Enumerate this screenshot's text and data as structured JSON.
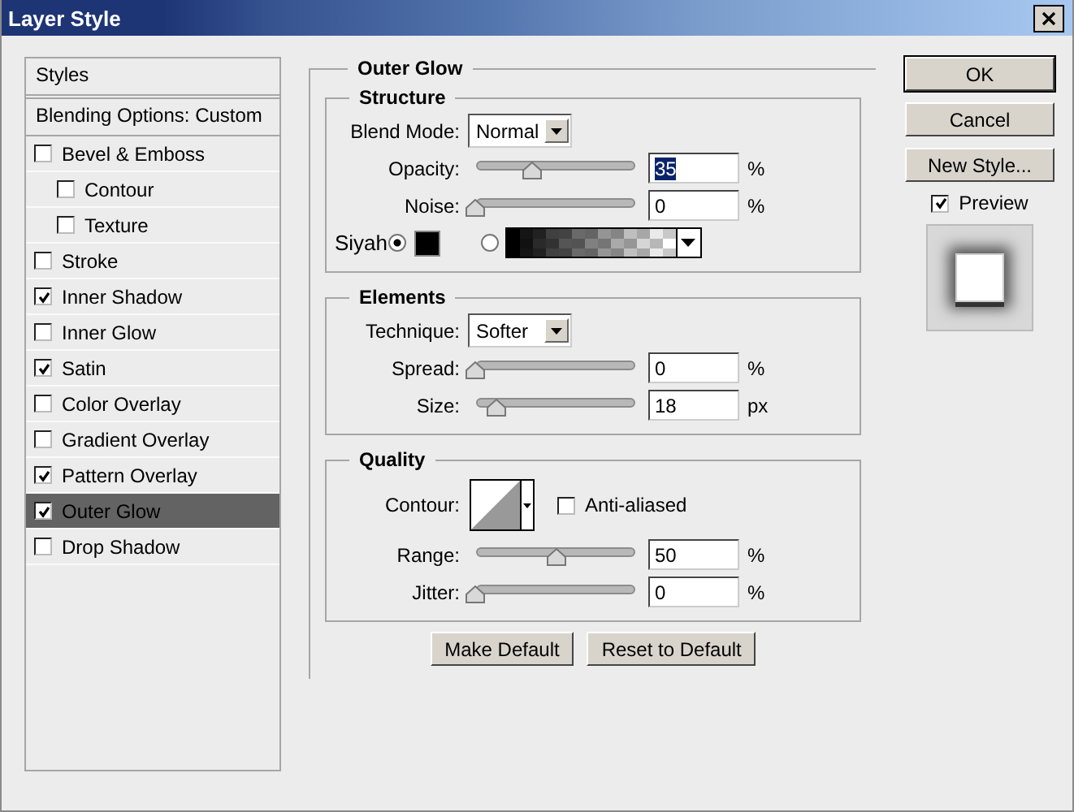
{
  "window": {
    "title": "Layer Style"
  },
  "sidebar": {
    "header": "Styles",
    "blending": "Blending Options: Custom",
    "items": [
      {
        "label": "Bevel & Emboss",
        "checked": false,
        "selected": false,
        "children": [
          {
            "label": "Contour",
            "checked": false,
            "selected": false
          },
          {
            "label": "Texture",
            "checked": false,
            "selected": false
          }
        ]
      },
      {
        "label": "Stroke",
        "checked": false,
        "selected": false
      },
      {
        "label": "Inner Shadow",
        "checked": true,
        "selected": false
      },
      {
        "label": "Inner Glow",
        "checked": false,
        "selected": false
      },
      {
        "label": "Satin",
        "checked": true,
        "selected": false
      },
      {
        "label": "Color Overlay",
        "checked": false,
        "selected": false
      },
      {
        "label": "Gradient Overlay",
        "checked": false,
        "selected": false
      },
      {
        "label": "Pattern Overlay",
        "checked": true,
        "selected": false
      },
      {
        "label": "Outer Glow",
        "checked": true,
        "selected": true
      },
      {
        "label": "Drop Shadow",
        "checked": false,
        "selected": false
      }
    ]
  },
  "panel": {
    "title": "Outer Glow",
    "groups": [
      {
        "title": "Structure",
        "rows": [
          {
            "kind": "dropdown",
            "label": "Blend Mode:",
            "value": "Normal"
          },
          {
            "kind": "slider",
            "label": "Opacity:",
            "level": 0.35,
            "value": "35",
            "unit": "%",
            "text_selected": true
          },
          {
            "kind": "slider",
            "label": "Noise:",
            "level": 0,
            "value": "0",
            "unit": "%",
            "text_selected": false
          },
          {
            "kind": "fill",
            "label": "Siyah",
            "options": [
              {
                "kind": "solid",
                "selected": true
              },
              {
                "kind": "gradient",
                "selected": false
              }
            ]
          }
        ]
      },
      {
        "title": "Elements",
        "rows": [
          {
            "kind": "dropdown",
            "label": "Technique:",
            "value": "Softer"
          },
          {
            "kind": "slider",
            "label": "Spread:",
            "level": 0,
            "value": "0",
            "unit": "%",
            "text_selected": false
          },
          {
            "kind": "slider",
            "label": "Size:",
            "level": 0.13,
            "value": "18",
            "unit": "px",
            "text_selected": false
          }
        ]
      },
      {
        "title": "Quality",
        "rows": [
          {
            "kind": "contour",
            "label": "Contour:",
            "option": {
              "label": "Anti-aliased",
              "checked": false
            }
          },
          {
            "kind": "slider",
            "label": "Range:",
            "level": 0.5,
            "value": "50",
            "unit": "%",
            "text_selected": false
          },
          {
            "kind": "slider",
            "label": "Jitter:",
            "level": 0,
            "value": "0",
            "unit": "%",
            "text_selected": false
          }
        ]
      }
    ],
    "buttons": [
      "Make Default",
      "Reset to Default"
    ]
  },
  "actions": [
    {
      "label": "OK",
      "default": true
    },
    {
      "label": "Cancel",
      "default": false
    },
    {
      "label": "New Style...",
      "default": false
    }
  ],
  "preview": {
    "label": "Preview",
    "checked": true
  }
}
